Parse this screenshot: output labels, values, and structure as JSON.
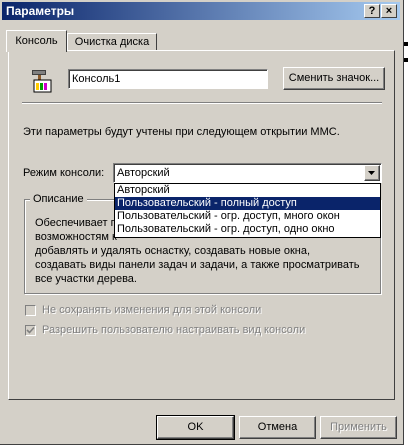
{
  "window": {
    "title": "Параметры"
  },
  "titlebar_buttons": {
    "help": "?",
    "close": "×"
  },
  "tabs": [
    {
      "label": "Консоль",
      "active": true
    },
    {
      "label": "Очистка диска",
      "active": false
    }
  ],
  "console": {
    "name_value": "Консоль1",
    "change_icon_label": "Сменить значок...",
    "info_text": "Эти параметры будут учтены при следующем открытии MMC.",
    "mode_label": "Режим консоли:",
    "mode_selected": "Авторский",
    "mode_options": [
      "Авторский",
      "Пользовательский - полный доступ",
      "Пользовательский - огр. доступ, много окон",
      "Пользовательский - огр. доступ, одно окно"
    ],
    "mode_highlighted_index": 1,
    "description_title": "Описание",
    "description_lines": [
      "Обеспечивает п",
      "возможностям к",
      "добавлять и удалять оснастку, создавать новые окна,",
      "создавать виды панели задач и задачи, а также просматривать",
      "все участки дерева."
    ],
    "description_right_fragment": "",
    "checkbox_no_save": {
      "label": "Не сохранять изменения для этой консоли",
      "checked": false,
      "enabled": false
    },
    "checkbox_allow_customize": {
      "label": "Разрешить пользователю настраивать вид консоли",
      "checked": true,
      "enabled": false
    }
  },
  "buttons": {
    "ok": "OK",
    "cancel": "Отмена",
    "apply": "Применить"
  }
}
